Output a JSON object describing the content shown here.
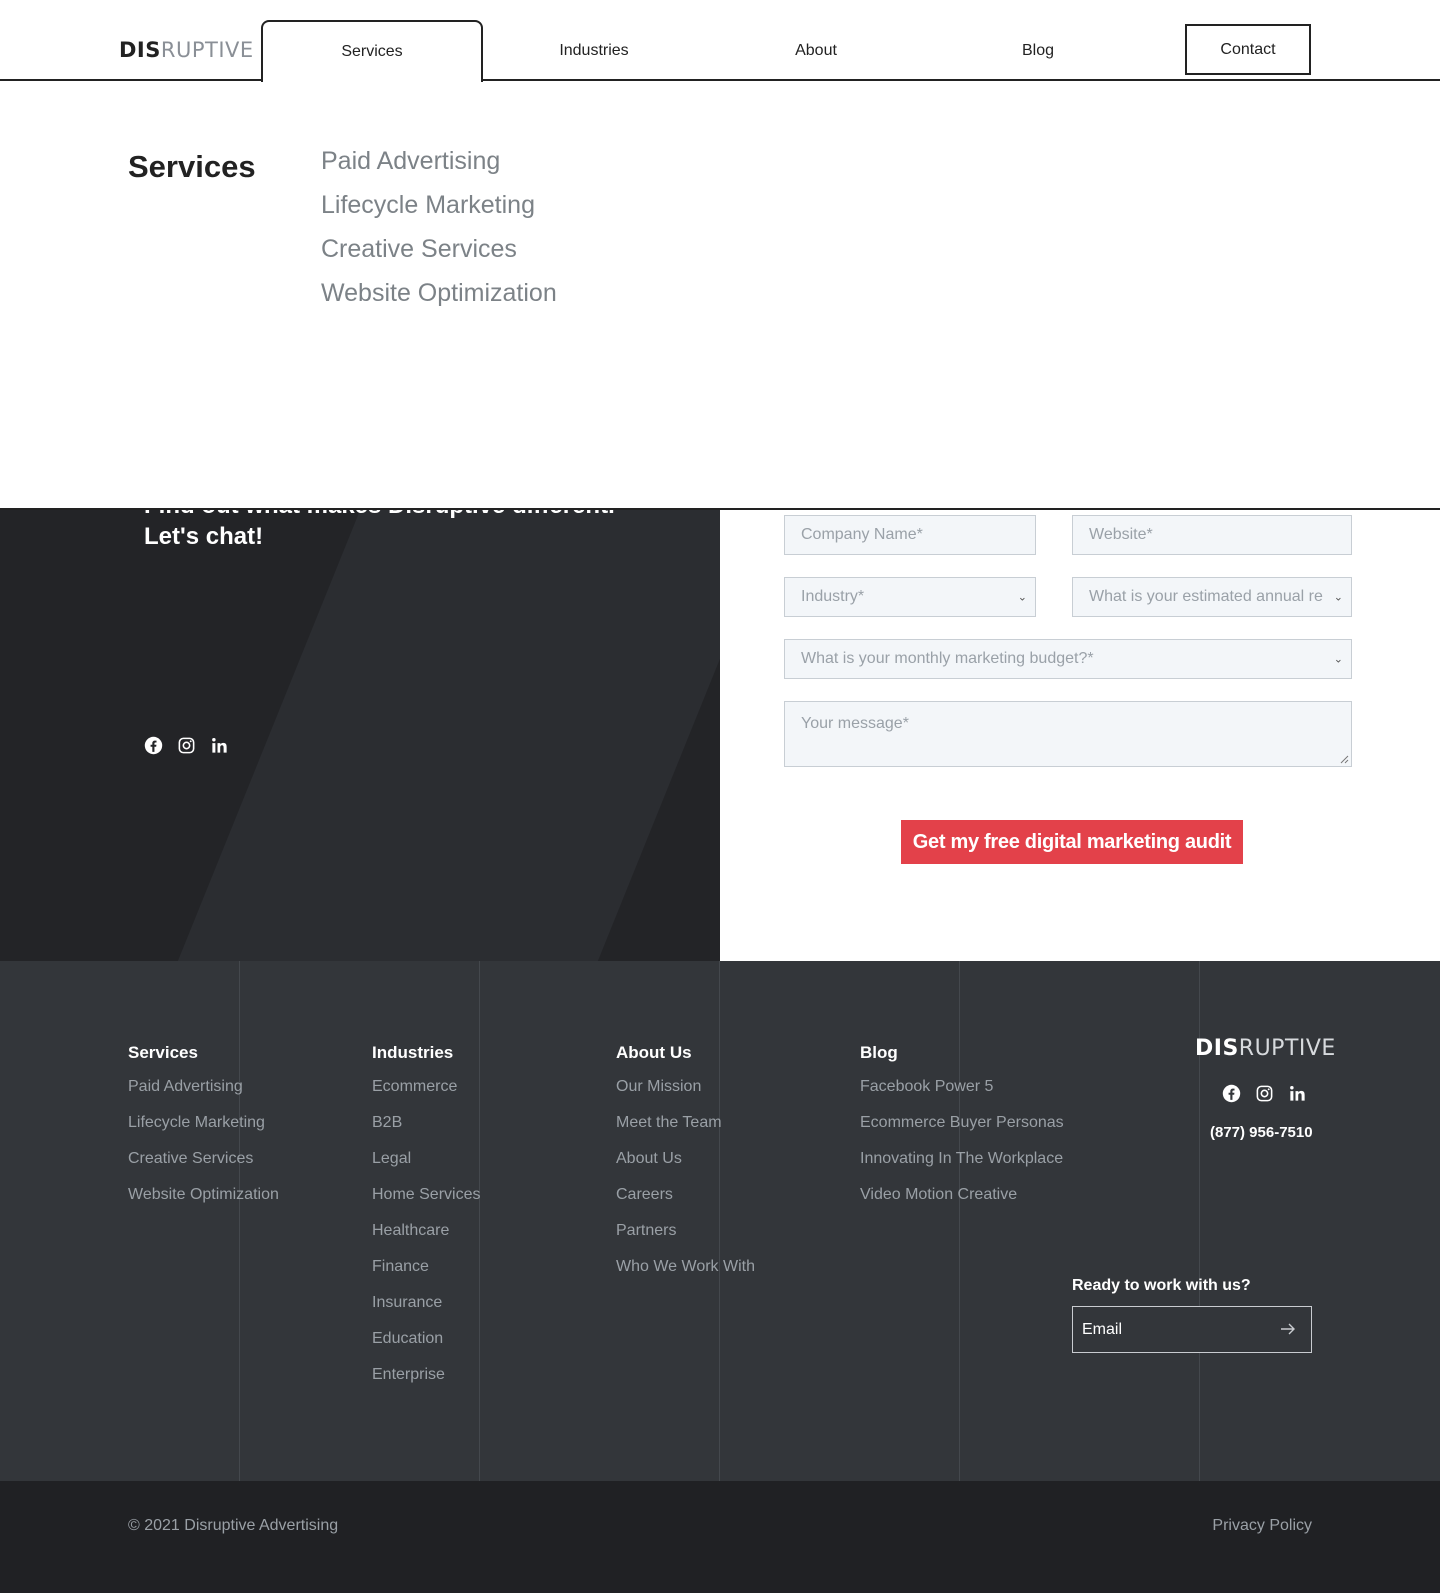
{
  "header": {
    "logo_bold": "DIS",
    "logo_light": "RUPTIVE",
    "nav": [
      {
        "label": "Services"
      },
      {
        "label": "Industries"
      },
      {
        "label": "About"
      },
      {
        "label": "Blog"
      }
    ],
    "contact_label": "Contact"
  },
  "dropdown": {
    "title": "Services",
    "links": [
      "Paid Advertising",
      "Lifecycle Marketing",
      "Creative Services",
      "Website Optimization"
    ]
  },
  "contact": {
    "headline_line1": "Find out what makes Disruptive different.",
    "headline_line2": "Let's chat!",
    "form": {
      "company_placeholder": "Company Name*",
      "website_placeholder": "Website*",
      "industry_placeholder": "Industry*",
      "revenue_placeholder": "What is your estimated annual re",
      "budget_placeholder": "What is your monthly marketing budget?*",
      "message_placeholder": "Your message*",
      "submit_label": "Get my free digital marketing audit"
    }
  },
  "footer": {
    "columns": [
      {
        "title": "Services",
        "items": [
          "Paid Advertising",
          "Lifecycle Marketing",
          "Creative Services",
          "Website Optimization"
        ]
      },
      {
        "title": "Industries",
        "items": [
          "Ecommerce",
          "B2B",
          "Legal",
          "Home Services",
          "Healthcare",
          "Finance",
          "Insurance",
          "Education",
          "Enterprise"
        ]
      },
      {
        "title": "About Us",
        "items": [
          "Our Mission",
          "Meet the Team",
          "About Us",
          "Careers",
          "Partners",
          "Who We Work With"
        ]
      },
      {
        "title": "Blog",
        "items": [
          "Facebook Power 5",
          "Ecommerce Buyer Personas",
          "Innovating In The Workplace",
          "Video Motion Creative"
        ]
      }
    ],
    "logo_bold": "DIS",
    "logo_light": "RUPTIVE",
    "phone": "(877) 956-7510",
    "ready_label": "Ready to work with us?",
    "email_placeholder": "Email",
    "copyright": "© 2021 Disruptive Advertising",
    "privacy": "Privacy Policy"
  },
  "icons": [
    "facebook-icon",
    "instagram-icon",
    "linkedin-icon",
    "arrow-right-icon",
    "chevron-down-icon"
  ],
  "colors": {
    "accent": "#e3414a",
    "dark": "#232427",
    "footer": "#33363a",
    "bottom_bar": "#202124"
  }
}
